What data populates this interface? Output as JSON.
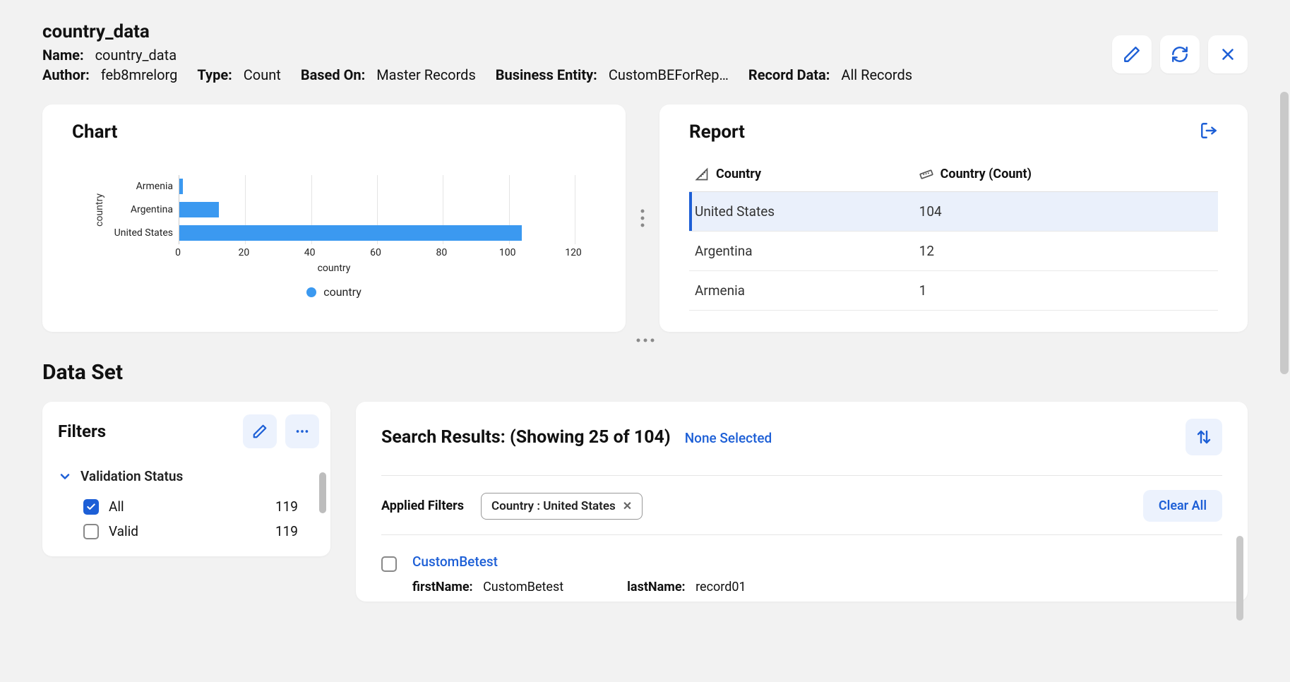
{
  "header": {
    "title": "country_data",
    "meta": {
      "name_label": "Name:",
      "name_value": "country_data",
      "author_label": "Author:",
      "author_value": "feb8mrelorg",
      "type_label": "Type:",
      "type_value": "Count",
      "based_on_label": "Based On:",
      "based_on_value": "Master Records",
      "entity_label": "Business Entity:",
      "entity_value": "CustomBEForRep…",
      "record_data_label": "Record Data:",
      "record_data_value": "All Records"
    }
  },
  "chart_panel": {
    "title": "Chart",
    "y_axis_title": "country",
    "x_axis_label": "country",
    "legend_label": "country",
    "x_ticks": [
      "0",
      "20",
      "40",
      "60",
      "80",
      "100",
      "120"
    ]
  },
  "chart_data": {
    "type": "bar",
    "orientation": "horizontal",
    "categories": [
      "Armenia",
      "Argentina",
      "United States"
    ],
    "values": [
      1,
      12,
      104
    ],
    "xlim": [
      0,
      120
    ],
    "xlabel": "country",
    "ylabel": "country",
    "legend": [
      "country"
    ]
  },
  "report_panel": {
    "title": "Report",
    "columns": {
      "col1": "Country",
      "col2": "Country (Count)"
    },
    "rows": [
      {
        "country": "United States",
        "count": "104",
        "selected": true
      },
      {
        "country": "Argentina",
        "count": "12",
        "selected": false
      },
      {
        "country": "Armenia",
        "count": "1",
        "selected": false
      }
    ]
  },
  "dataset": {
    "title": "Data Set"
  },
  "filters": {
    "title": "Filters",
    "group1": {
      "label": "Validation Status",
      "options": [
        {
          "label": "All",
          "count": "119",
          "checked": true
        },
        {
          "label": "Valid",
          "count": "119",
          "checked": false
        }
      ]
    }
  },
  "results": {
    "title": "Search Results: (Showing 25 of 104)",
    "none_selected": "None Selected",
    "applied_filters_label": "Applied Filters",
    "chip_text": "Country : United States",
    "clear_all": "Clear All",
    "item": {
      "link": "CustomBetest",
      "firstName_label": "firstName:",
      "firstName_value": "CustomBetest",
      "lastName_label": "lastName:",
      "lastName_value": "record01"
    }
  }
}
